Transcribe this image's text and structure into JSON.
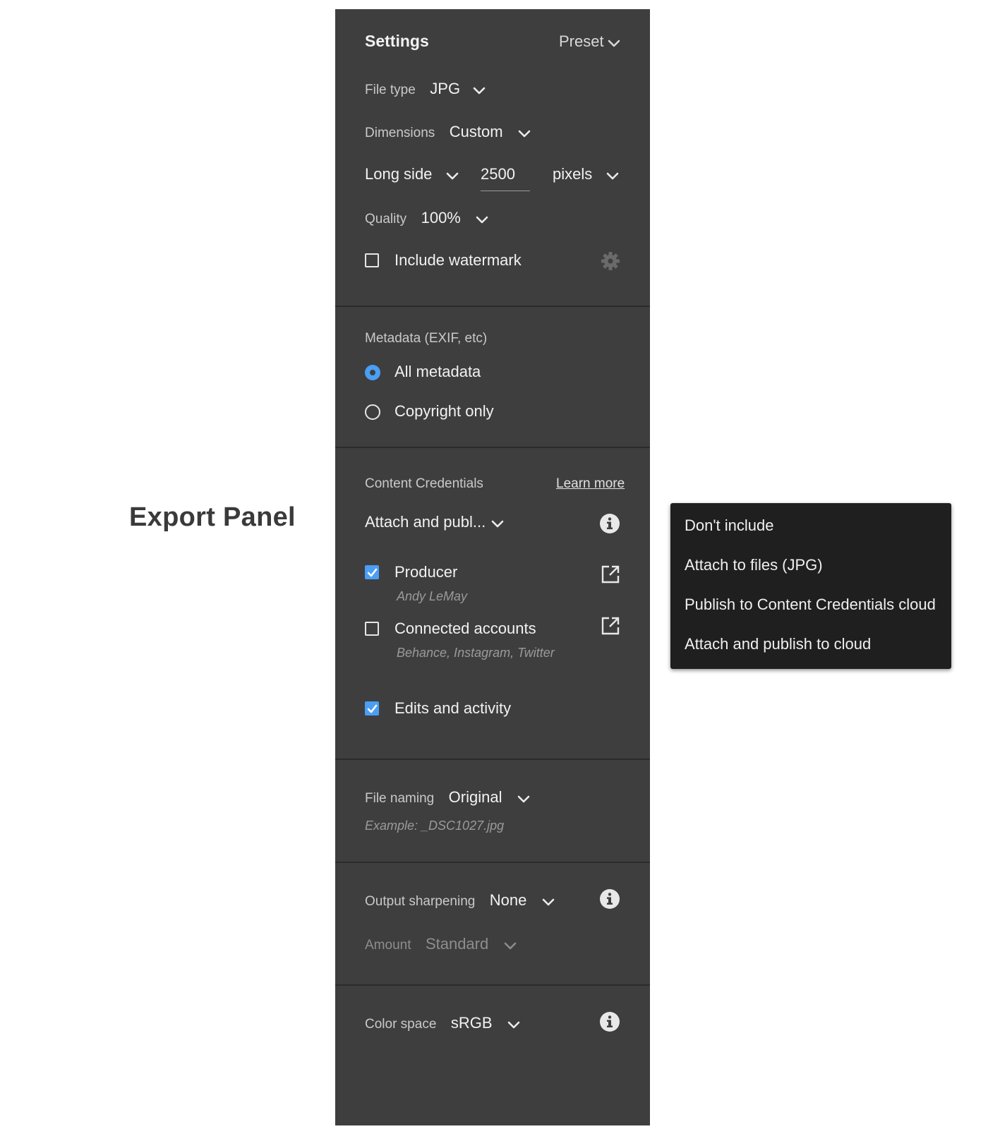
{
  "page_title": "Export Panel",
  "settings": {
    "heading": "Settings",
    "preset_label": "Preset",
    "file_type": {
      "label": "File type",
      "value": "JPG"
    },
    "dimensions": {
      "label": "Dimensions",
      "value": "Custom"
    },
    "size": {
      "side": "Long side",
      "value": "2500",
      "unit": "pixels"
    },
    "quality": {
      "label": "Quality",
      "value": "100%"
    },
    "watermark": {
      "label": "Include watermark",
      "checked": false,
      "icon": "gear-icon"
    }
  },
  "metadata": {
    "heading": "Metadata (EXIF, etc)",
    "options": [
      {
        "label": "All metadata",
        "selected": true
      },
      {
        "label": "Copyright only",
        "selected": false
      }
    ]
  },
  "content_credentials": {
    "heading": "Content Credentials",
    "learn_more": "Learn more",
    "mode_value": "Attach and publ...",
    "producer": {
      "label": "Producer",
      "sub": "Andy LeMay",
      "checked": true
    },
    "connected": {
      "label": "Connected accounts",
      "sub": "Behance, Instagram, Twitter",
      "checked": false
    },
    "edits": {
      "label": "Edits and activity",
      "checked": true
    }
  },
  "file_naming": {
    "label": "File naming",
    "value": "Original",
    "example": "Example: _DSC1027.jpg"
  },
  "sharpening": {
    "label": "Output sharpening",
    "value": "None",
    "amount_label": "Amount",
    "amount_value": "Standard"
  },
  "color_space": {
    "label": "Color space",
    "value": "sRGB"
  },
  "dropdown_menu": {
    "items": [
      "Don't include",
      "Attach to files (JPG)",
      "Publish to Content Credentials cloud",
      "Attach and publish to cloud"
    ]
  },
  "colors": {
    "panel_bg": "#3e3e3e",
    "accent": "#4a9ef4",
    "menu_bg": "#1f1f1f"
  }
}
